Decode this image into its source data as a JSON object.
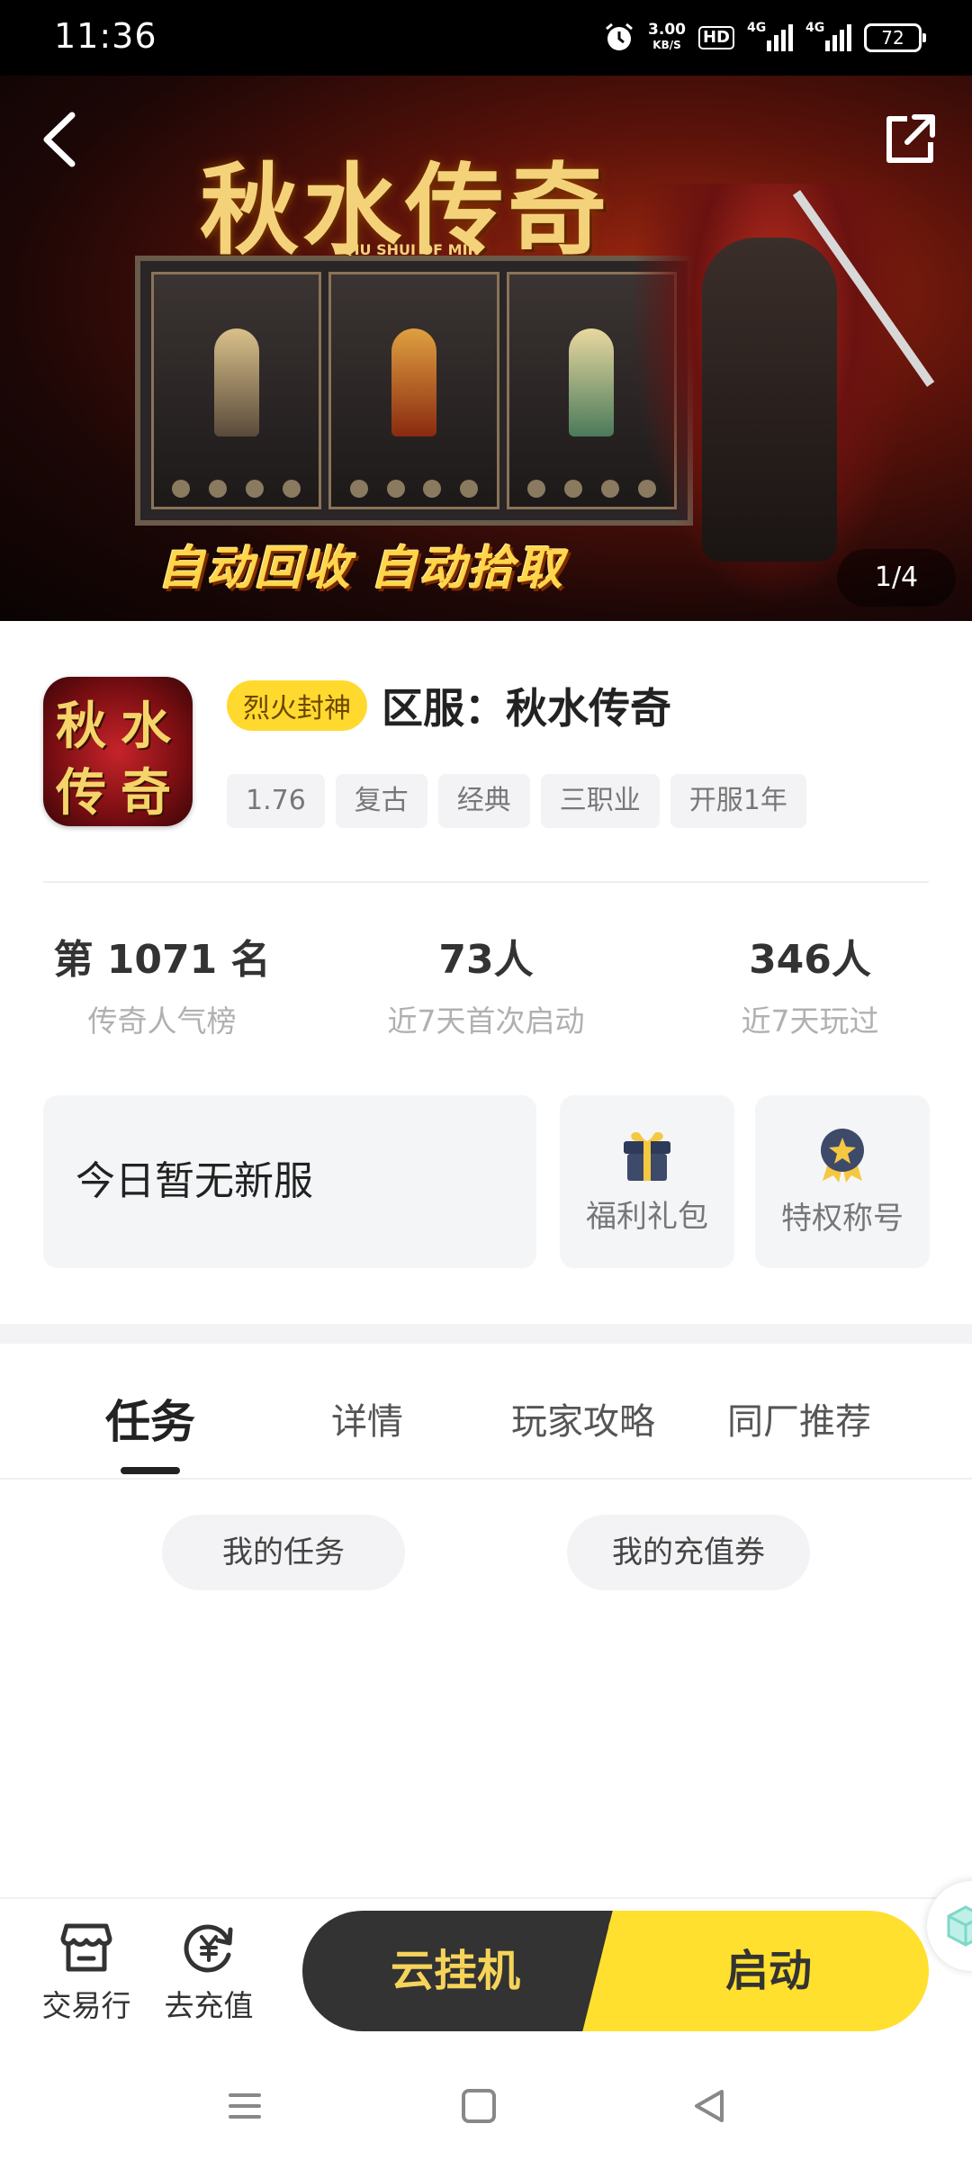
{
  "status_bar": {
    "time": "11:36",
    "net_speed_value": "3.00",
    "net_speed_unit": "KB/S",
    "hd_label": "HD",
    "signal_1": "4G",
    "signal_2": "4G",
    "battery": "72",
    "icons": [
      "alarm-icon",
      "signal-icon",
      "signal-icon"
    ]
  },
  "banner": {
    "title": "秋水传奇",
    "subtitle": "QIU SHUI OF MIR",
    "slogan": "自动回收 自动拾取",
    "counter": "1/4",
    "back_icon": "chevron-left-icon",
    "share_icon": "share-icon"
  },
  "game": {
    "icon_text": [
      "秋",
      "水",
      "传",
      "奇"
    ],
    "badge": "烈火封神",
    "name": "区服：秋水传奇",
    "tags": [
      "1.76",
      "复古",
      "经典",
      "三职业",
      "开服1年"
    ]
  },
  "stats": [
    {
      "value": "第 1071 名",
      "label": "传奇人气榜"
    },
    {
      "value": "73人",
      "label": "近7天首次启动"
    },
    {
      "value": "346人",
      "label": "近7天玩过"
    }
  ],
  "cards": {
    "server": "今日暂无新服",
    "gift": "福利礼包",
    "title": "特权称号"
  },
  "tabs": [
    {
      "label": "任务",
      "active": true
    },
    {
      "label": "详情",
      "active": false
    },
    {
      "label": "玩家攻略",
      "active": false
    },
    {
      "label": "同厂推荐",
      "active": false
    }
  ],
  "task_buttons": {
    "my_tasks": "我的任务",
    "my_vouchers": "我的充值券"
  },
  "bottom_bar": {
    "trade": "交易行",
    "recharge": "去充值",
    "cloud": "云挂机",
    "start": "启动"
  },
  "colors": {
    "accent_yellow": "#ffe02e",
    "dark_button": "#333333",
    "cloud_text": "#f6d45a"
  }
}
